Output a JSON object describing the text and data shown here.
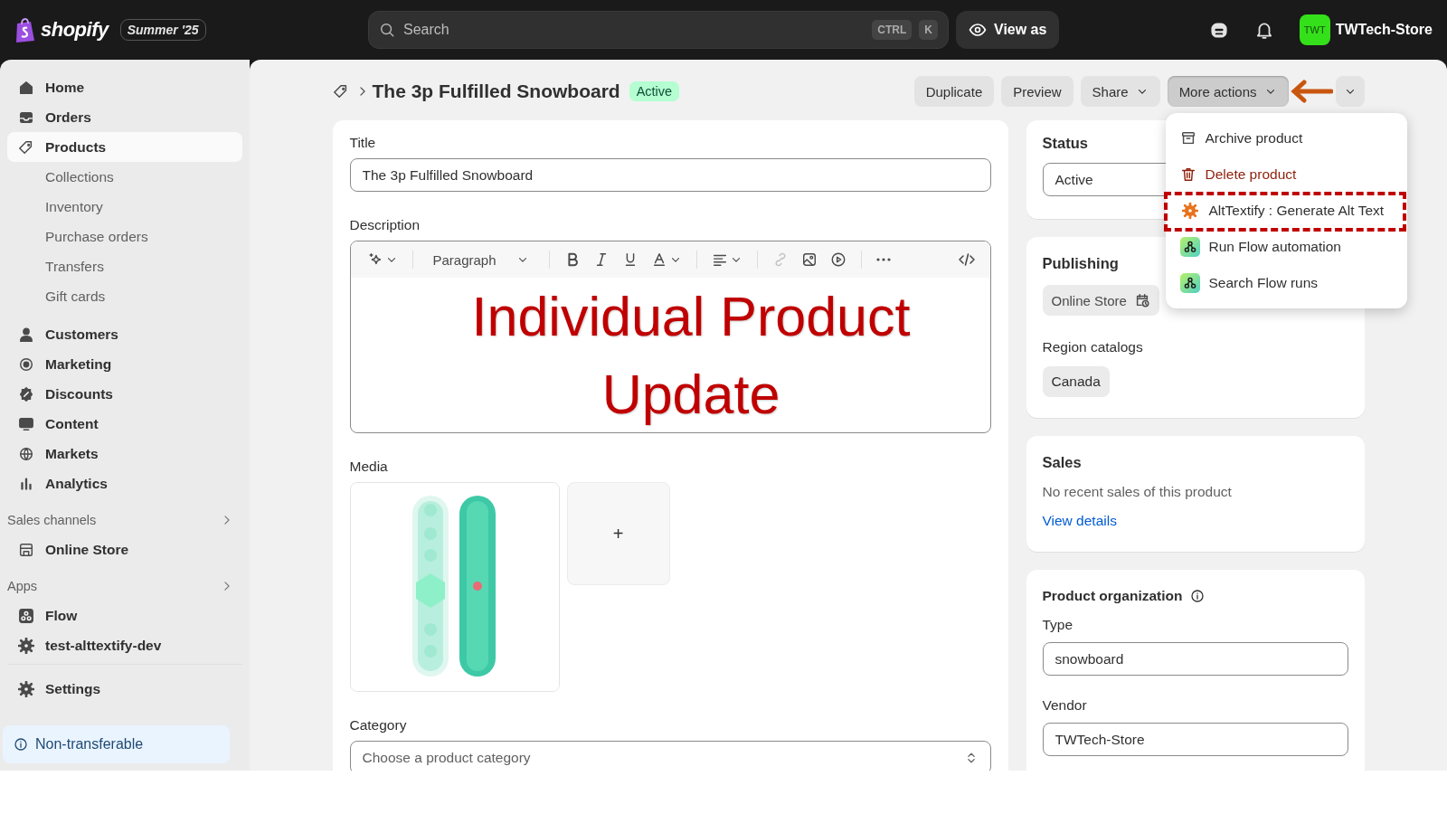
{
  "topbar": {
    "logo": "shopify",
    "edition": "Summer '25",
    "search": {
      "placeholder": "Search"
    },
    "shortcut": [
      "CTRL",
      "K"
    ],
    "view_as": "View as",
    "store": {
      "initials": "TWT",
      "name": "TWTech-Store"
    }
  },
  "sidebar": {
    "items": [
      {
        "label": "Home",
        "selected": false
      },
      {
        "label": "Orders",
        "selected": false
      },
      {
        "label": "Products",
        "selected": true,
        "children": [
          {
            "label": "Collections",
            "selected": false
          },
          {
            "label": "Inventory",
            "selected": false
          },
          {
            "label": "Purchase orders",
            "selected": false
          },
          {
            "label": "Transfers",
            "selected": false
          },
          {
            "label": "Gift cards",
            "selected": false
          }
        ]
      },
      {
        "label": "Customers",
        "selected": false
      },
      {
        "label": "Marketing",
        "selected": false
      },
      {
        "label": "Discounts",
        "selected": false
      },
      {
        "label": "Content",
        "selected": false
      },
      {
        "label": "Markets",
        "selected": false
      },
      {
        "label": "Analytics",
        "selected": false
      }
    ],
    "sections": [
      {
        "title": "Sales channels",
        "items": [
          {
            "label": "Online Store",
            "selected": false
          }
        ]
      },
      {
        "title": "Apps",
        "items": [
          {
            "label": "Flow",
            "selected": false
          },
          {
            "label": "test-alttextify-dev",
            "selected": false
          }
        ]
      }
    ],
    "settings": "Settings",
    "notice": "Non-transferable"
  },
  "page": {
    "title": "The 3p Fulfilled Snowboard",
    "status": "Active",
    "actions": [
      {
        "label": "Duplicate",
        "has_menu": false,
        "expanded": false
      },
      {
        "label": "Preview",
        "has_menu": false,
        "expanded": false
      },
      {
        "label": "Share",
        "has_menu": true,
        "expanded": false
      },
      {
        "label": "More actions",
        "has_menu": true,
        "expanded": true
      }
    ],
    "menu": [
      {
        "label": "Archive product",
        "kind": "default",
        "highlighted": false
      },
      {
        "label": "Delete product",
        "kind": "destructive",
        "highlighted": false
      },
      {
        "label": "AltTextify : Generate Alt Text",
        "kind": "app",
        "highlighted": true
      },
      {
        "label": "Run Flow automation",
        "kind": "app",
        "highlighted": false
      },
      {
        "label": "Search Flow runs",
        "kind": "app",
        "highlighted": false
      }
    ]
  },
  "main": {
    "title": {
      "label": "Title",
      "value": "The 3p Fulfilled Snowboard"
    },
    "description": {
      "label": "Description",
      "block_format": "Paragraph",
      "content": "Individual Product Update"
    },
    "media": {
      "label": "Media",
      "add": "+"
    },
    "category": {
      "label": "Category",
      "placeholder": "Choose a product category"
    }
  },
  "side": {
    "status": {
      "label": "Status",
      "value": "Active"
    },
    "publishing": {
      "label": "Publishing",
      "channels": [
        "Online Store"
      ],
      "region_label": "Region catalogs",
      "regions": [
        "Canada"
      ]
    },
    "sales": {
      "title": "Sales",
      "text": "No recent sales of this product",
      "link": "View details"
    },
    "organization": {
      "title": "Product organization",
      "type": {
        "label": "Type",
        "value": "snowboard"
      },
      "vendor": {
        "label": "Vendor",
        "value": "TWTech-Store"
      }
    }
  }
}
